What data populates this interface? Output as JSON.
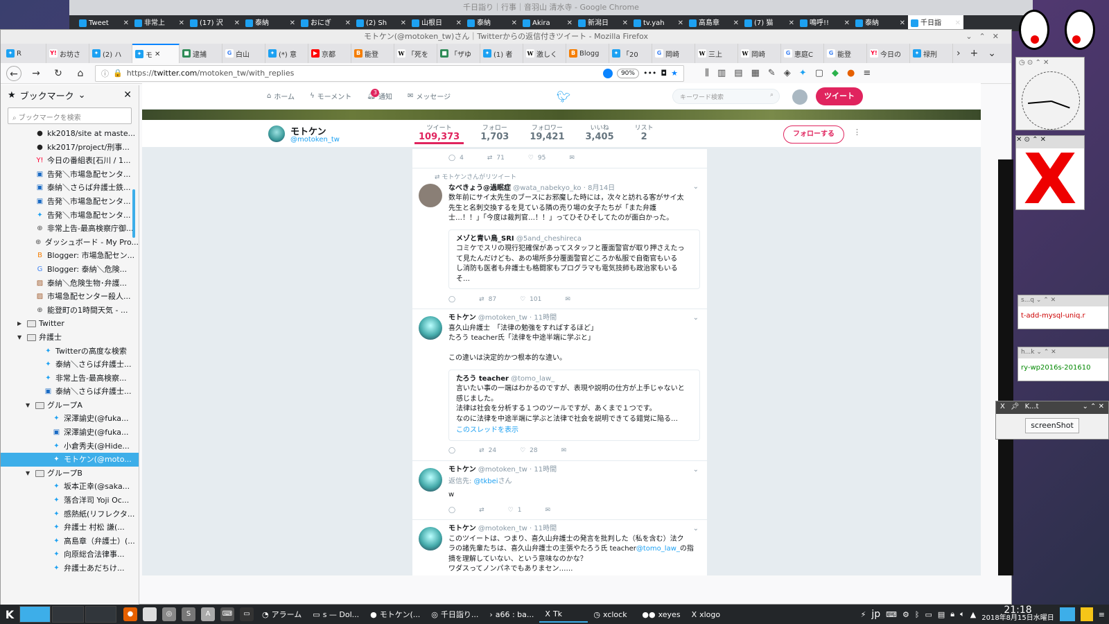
{
  "chrome": {
    "title": "千日詣り｜行事｜音羽山 清水寺 - Google Chrome",
    "tabs": [
      "Tweet",
      "非常上",
      "(17) 沢",
      "泰納",
      "おにぎ",
      "(2) Sh",
      "山根日",
      "泰納",
      "Akira",
      "新潟日",
      "tv.yah",
      "高島章",
      "(7) 猫",
      "鳴呼!!",
      "泰納",
      "千日詣"
    ]
  },
  "firefox": {
    "title": "モトケン(@motoken_tw)さん｜Twitterからの返信付きツイート - Mozilla Firefox",
    "tabs": [
      {
        "label": "R",
        "icon": "tw"
      },
      {
        "label": "お坊さ",
        "icon": "ya"
      },
      {
        "label": "(2) ハ",
        "icon": "tw"
      },
      {
        "label": "モ",
        "icon": "tw"
      },
      {
        "label": "逮捕",
        "icon": "gr"
      },
      {
        "label": "白山",
        "icon": "g"
      },
      {
        "label": "(*) 意",
        "icon": "tw"
      },
      {
        "label": "京都",
        "icon": "yt"
      },
      {
        "label": "能登",
        "icon": "bl"
      },
      {
        "label": "「死を",
        "icon": "w"
      },
      {
        "label": "「ザゆ",
        "icon": "gr"
      },
      {
        "label": "(1) 者",
        "icon": "tw"
      },
      {
        "label": "激しく",
        "icon": "w"
      },
      {
        "label": "Blogg",
        "icon": "bl"
      },
      {
        "label": "「20",
        "icon": "tw"
      },
      {
        "label": "岡崎",
        "icon": "g"
      },
      {
        "label": "三上",
        "icon": "w"
      },
      {
        "label": "岡崎",
        "icon": "w"
      },
      {
        "label": "恵庭C",
        "icon": "g"
      },
      {
        "label": "能登",
        "icon": "g"
      },
      {
        "label": "今日の",
        "icon": "ya"
      },
      {
        "label": "禄刑",
        "icon": "tw"
      }
    ],
    "url_prefix": "https://",
    "url_host": "twitter.com",
    "url_path": "/motoken_tw/with_replies",
    "zoom": "90%"
  },
  "sidebar": {
    "title": "ブックマーク",
    "search_placeholder": "ブックマークを検索",
    "items": [
      {
        "label": "kk2018/site at maste...",
        "indent": 3,
        "icon": "github"
      },
      {
        "label": "kk2017/project/刑事...",
        "indent": 3,
        "icon": "github"
      },
      {
        "label": "今日の番組表[石川 / 1...",
        "indent": 3,
        "icon": "yahoo"
      },
      {
        "label": "告発＼市場急配センタ...",
        "indent": 3,
        "icon": "doc"
      },
      {
        "label": "泰納＼さらば弁護士鉄...",
        "indent": 3,
        "icon": "doc"
      },
      {
        "label": "告発＼市場急配センタ...",
        "indent": 3,
        "icon": "doc"
      },
      {
        "label": "告発＼市場急配センタ...",
        "indent": 3,
        "icon": "twitter"
      },
      {
        "label": "非常上告-最高検察庁御...",
        "indent": 3,
        "icon": "globe"
      },
      {
        "label": "ダッシュボード - My Pro...",
        "indent": 3,
        "icon": "globe"
      },
      {
        "label": "Blogger: 市場急配セン...",
        "indent": 3,
        "icon": "blogger"
      },
      {
        "label": "Blogger: 泰納＼危険...",
        "indent": 3,
        "icon": "google"
      },
      {
        "label": "泰納＼危険生物･弁護...",
        "indent": 3,
        "icon": "photo"
      },
      {
        "label": "市場急配センター殺人...",
        "indent": 3,
        "icon": "photo"
      },
      {
        "label": "能登町の1時間天気 - ...",
        "indent": 3,
        "icon": "globe"
      },
      {
        "label": "Twitter",
        "indent": 2,
        "icon": "folder",
        "tri": "▶"
      },
      {
        "label": "弁護士",
        "indent": 2,
        "icon": "folder",
        "tri": "▼"
      },
      {
        "label": "Twitterの高度な検索",
        "indent": 4,
        "icon": "twitter"
      },
      {
        "label": "泰納＼さらば弁護士...",
        "indent": 4,
        "icon": "twitter"
      },
      {
        "label": "非常上告-最高検察...",
        "indent": 4,
        "icon": "twitter"
      },
      {
        "label": "泰納＼さらば弁護士...",
        "indent": 4,
        "icon": "doc"
      },
      {
        "label": "グループA",
        "indent": 3,
        "icon": "folder",
        "tri": "▼"
      },
      {
        "label": "深澤諭史(@fuka...",
        "indent": 5,
        "icon": "twitter"
      },
      {
        "label": "深澤諭史(@fuka...",
        "indent": 5,
        "icon": "doc"
      },
      {
        "label": "小倉秀夫(@Hide...",
        "indent": 5,
        "icon": "twitter"
      },
      {
        "label": "モトケン(@moto...",
        "indent": 5,
        "icon": "twitter",
        "selected": true
      },
      {
        "label": "グループB",
        "indent": 3,
        "icon": "folder",
        "tri": "▼"
      },
      {
        "label": "坂本正幸(@saka...",
        "indent": 5,
        "icon": "twitter"
      },
      {
        "label": "落合洋司 Yoji Oc...",
        "indent": 5,
        "icon": "twitter"
      },
      {
        "label": "感熱紙(リフレクタ...",
        "indent": 5,
        "icon": "twitter"
      },
      {
        "label": "弁護士 村松 謙(...",
        "indent": 5,
        "icon": "twitter"
      },
      {
        "label": "高島章（弁護士）(...",
        "indent": 5,
        "icon": "twitter"
      },
      {
        "label": "向原総合法律事...",
        "indent": 5,
        "icon": "twitter"
      },
      {
        "label": "弁護士あだちけ...",
        "indent": 5,
        "icon": "twitter"
      }
    ]
  },
  "twitter": {
    "nav": {
      "home": "ホーム",
      "moments": "モーメント",
      "notifications": "通知",
      "notif_count": "3",
      "messages": "メッセージ"
    },
    "search_placeholder": "キーワード検索",
    "tweet_button": "ツイート",
    "profile": {
      "name": "モトケン",
      "handle": "@motoken_tw",
      "follow_button": "フォローする",
      "stats": [
        {
          "label": "ツイート",
          "value": "109,373"
        },
        {
          "label": "フォロー",
          "value": "1,703"
        },
        {
          "label": "フォロワー",
          "value": "19,421"
        },
        {
          "label": "いいね",
          "value": "3,405"
        },
        {
          "label": "リスト",
          "value": "2"
        }
      ]
    },
    "tweets": [
      {
        "id": "t0",
        "actions": {
          "reply": "4",
          "retweet": "71",
          "like": "95"
        }
      },
      {
        "id": "t1",
        "retweet_note": "モトケンさんがリツイート",
        "name": "なべきょう@過眠症",
        "handle": "@wata_nabekyo_ko",
        "time": "8月14日",
        "lines": [
          "数年前にサイ太先生のブースにお邪魔した時には，次々と訪れる客がサイ太",
          "先生と名刺交換するを見ている隣の売り場の女子たちが「また弁護",
          "士…！！」「今度は裁判官…！！」ってひそひそしてたのが面白かった。"
        ],
        "quote": {
          "name": "メゾと青い鳥_SRI",
          "handle": "@5and_cheshireca",
          "lines": [
            "コミケでスリの現行犯確保があってスタッフと覆面警官が取り押さえたっ",
            "て見たんだけども、あの場所多分覆面警官どころか私服で自衛官もいる",
            "し消防も医者も弁護士も格闘家もプログラマも電気技師も政治家もいる",
            "そ…"
          ]
        },
        "actions": {
          "reply": "",
          "retweet": "87",
          "like": "101"
        }
      },
      {
        "id": "t2",
        "name": "モトケン",
        "handle": "@motoken_tw",
        "time": "11時間",
        "lines": [
          "喜久山弁護士　「法律の勉強をすればするほど」",
          "たろう teacher氏「法律を中途半端に学ぶと」",
          "",
          "この違いは決定的かつ根本的な違い。"
        ],
        "quote": {
          "name": "たろう teacher",
          "handle": "@tomo_law_",
          "lines": [
            "言いたい事の一端はわかるのですが、表現や説明の仕方が上手じゃないと",
            "感じました。",
            "法律は社会を分析する１つのツールですが、あくまで１つです。",
            "なのに法律を中途半端に学ぶと法律で社会を説明できてる錯覚に陥る…"
          ]
        },
        "thread_link": "このスレッドを表示",
        "actions": {
          "reply": "",
          "retweet": "24",
          "like": "28"
        }
      },
      {
        "id": "t3",
        "name": "モトケン",
        "handle": "@motoken_tw",
        "time": "11時間",
        "reply_to_prefix": "返信先: ",
        "reply_to_handle": "@tkbei",
        "reply_to_suffix": "さん",
        "lines": [
          "w"
        ],
        "actions": {
          "reply": "",
          "retweet": "",
          "like": "1"
        }
      },
      {
        "id": "t4",
        "name": "モトケン",
        "handle": "@motoken_tw",
        "time": "11時間",
        "line1": "このツイートは、つまり、喜久山弁護士の発言を批判した（私を含む）法ク",
        "line2_pre": "ラの諸先輩たちは、喜久山弁護士の主張やたろう氏 teacher",
        "line2_link": "@tomo_law_",
        "line2_post": "の指",
        "line3": "摘を理解していない、という意味なのかな？",
        "line4": "ワダスってノンパネでもありまセン……"
      }
    ]
  },
  "desktop": {
    "clock_hour_deg": 20,
    "side1": "t-add-mysql-uniq.r",
    "side2": "ry-wp2016s-201610",
    "shot_title": "K...t",
    "shot_button": "screenShot"
  },
  "taskbar": {
    "tasks": [
      {
        "label": "アラーム",
        "icon": "alarm"
      },
      {
        "label": "s — Dol...",
        "icon": "folder"
      },
      {
        "label": "モトケン(...",
        "icon": "firefox"
      },
      {
        "label": "千日詣り...",
        "icon": "chrome"
      },
      {
        "label": "a66 : ba...",
        "icon": "terminal"
      },
      {
        "label": "Tk",
        "icon": "tk"
      },
      {
        "label": "xclock",
        "icon": "clock"
      },
      {
        "label": "xeyes",
        "icon": "eyes"
      },
      {
        "label": "xlogo",
        "icon": "x"
      }
    ],
    "ime": "jp",
    "time": "21:18",
    "date": "2018年8月15日水曜日"
  }
}
